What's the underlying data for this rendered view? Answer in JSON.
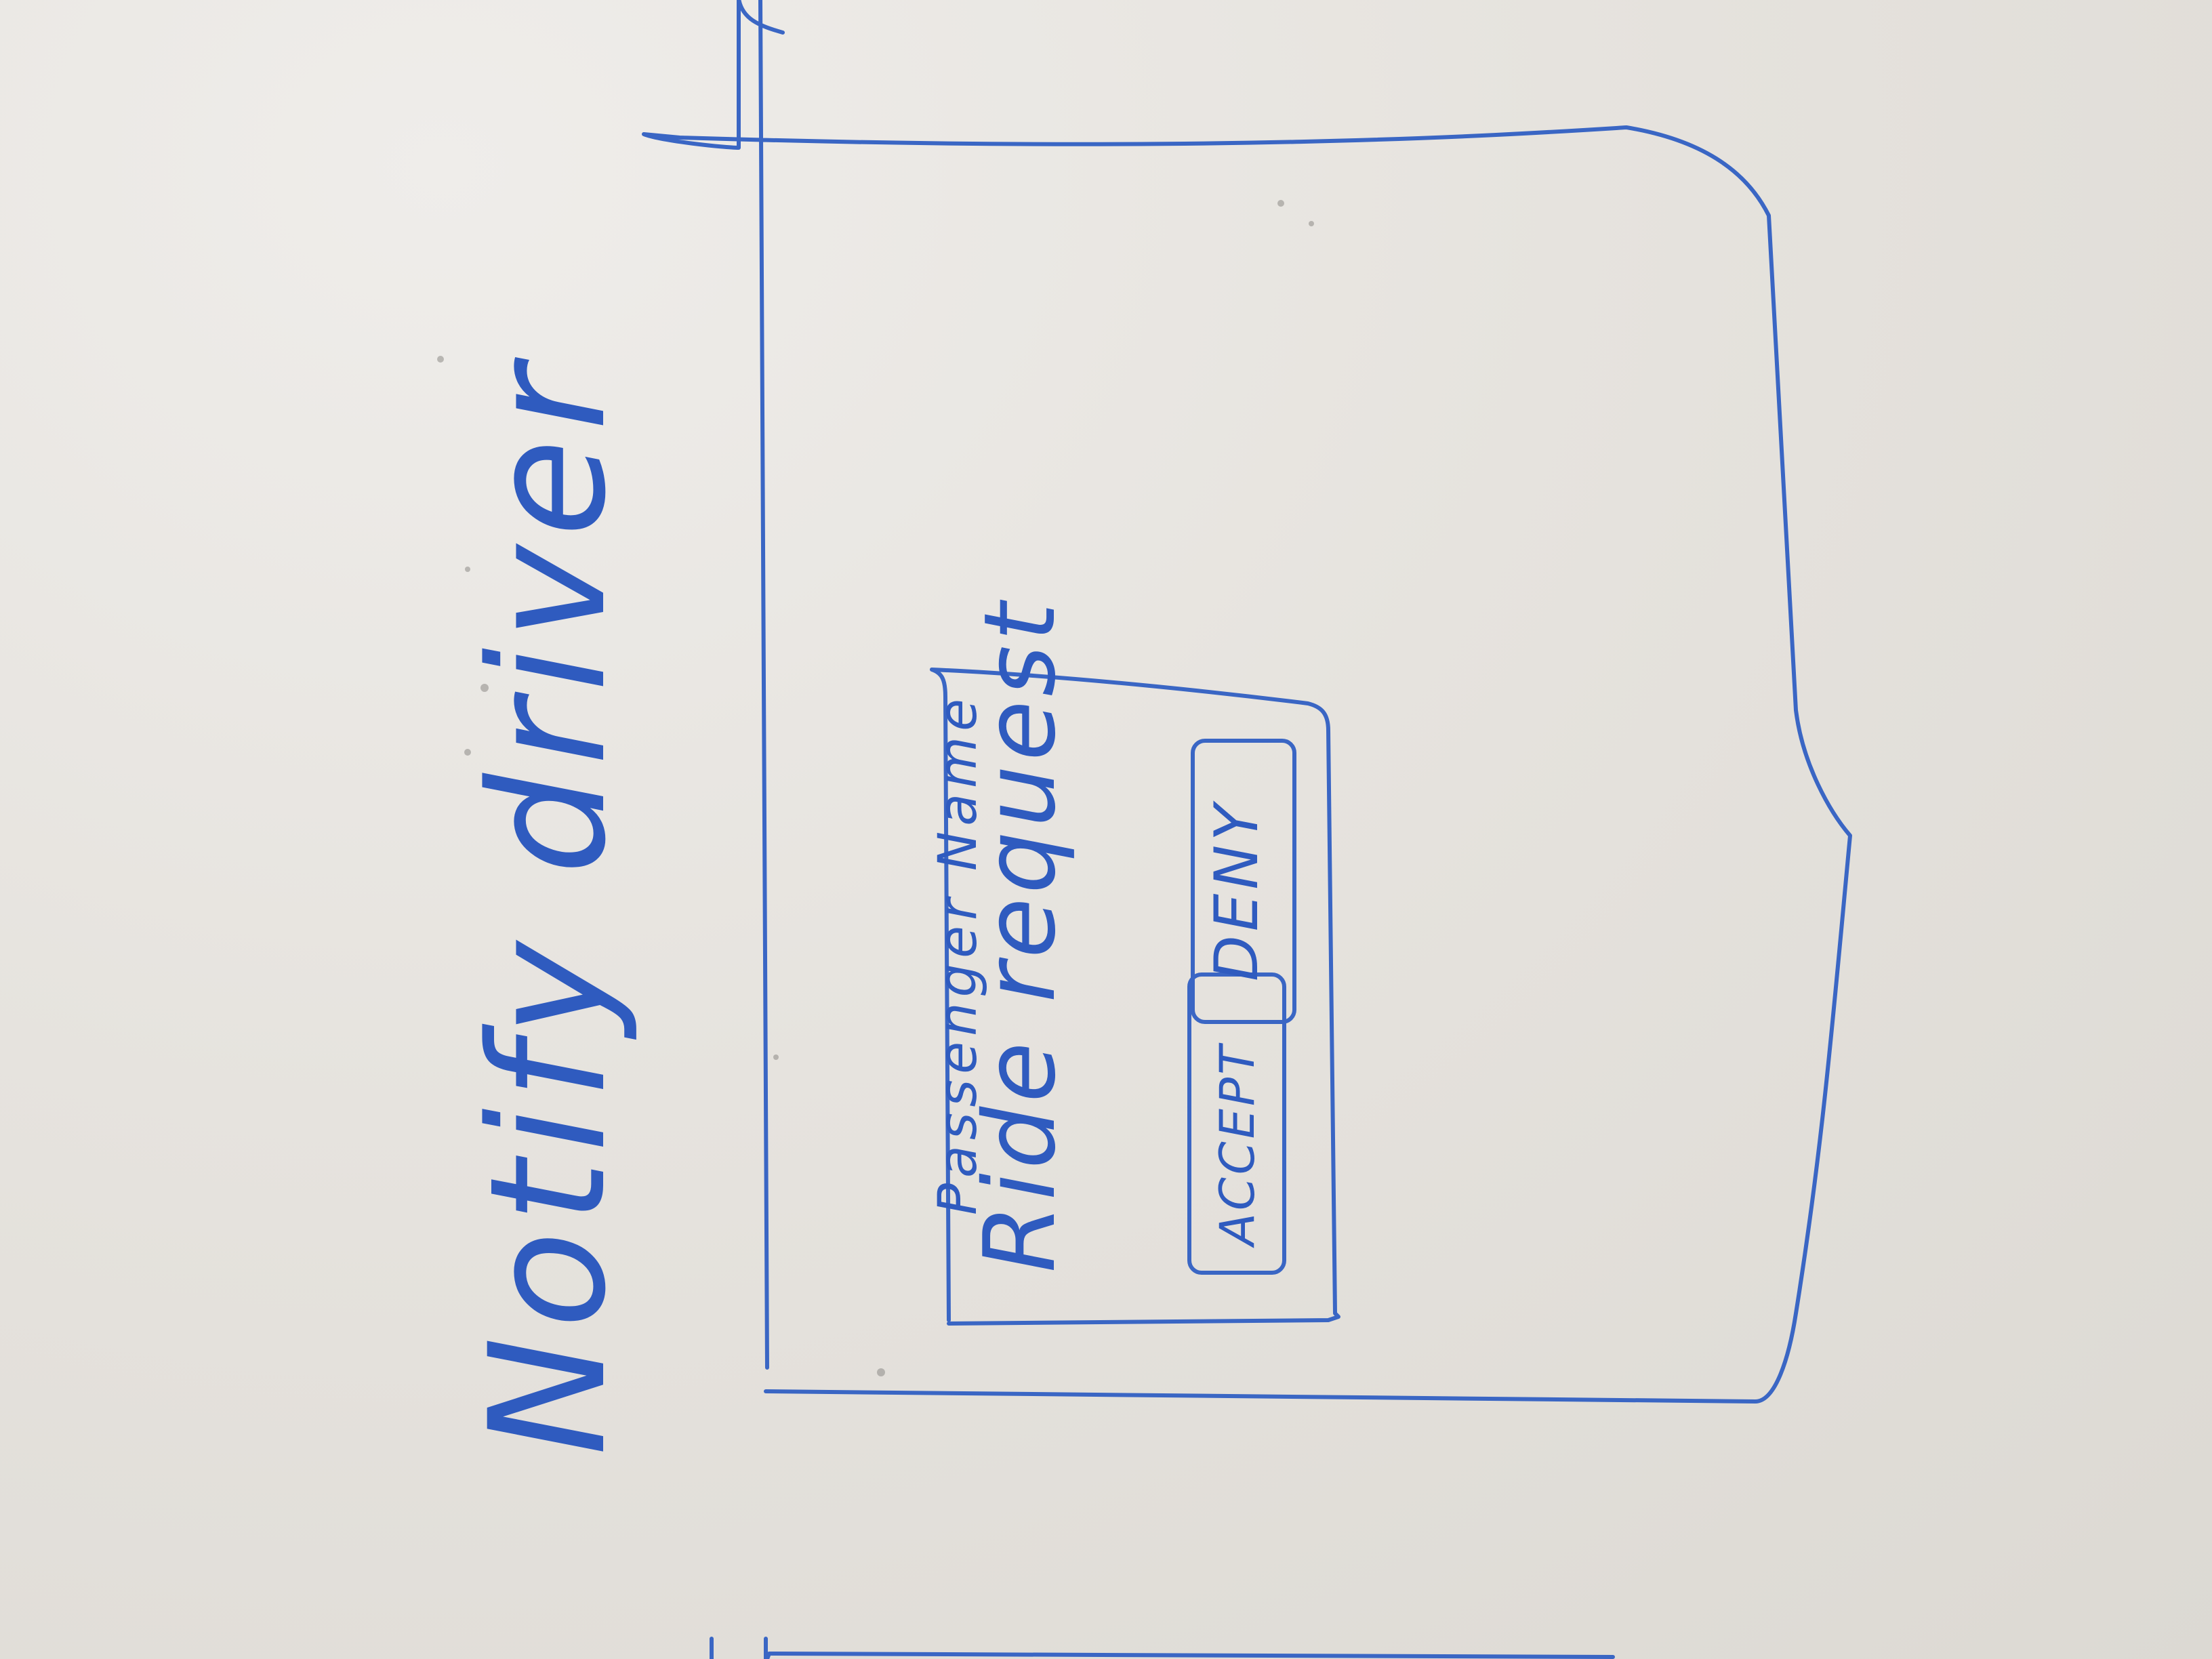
{
  "sketch": {
    "title": "Notify driver",
    "phone_screen": {
      "dialog": {
        "passenger_label": "Passenger Name",
        "request_label": "Ride request",
        "accept_button": "ACCEPT",
        "deny_button": "DENY"
      }
    }
  },
  "colors": {
    "ink": "#3a66c4",
    "board": "#e6e3de"
  }
}
